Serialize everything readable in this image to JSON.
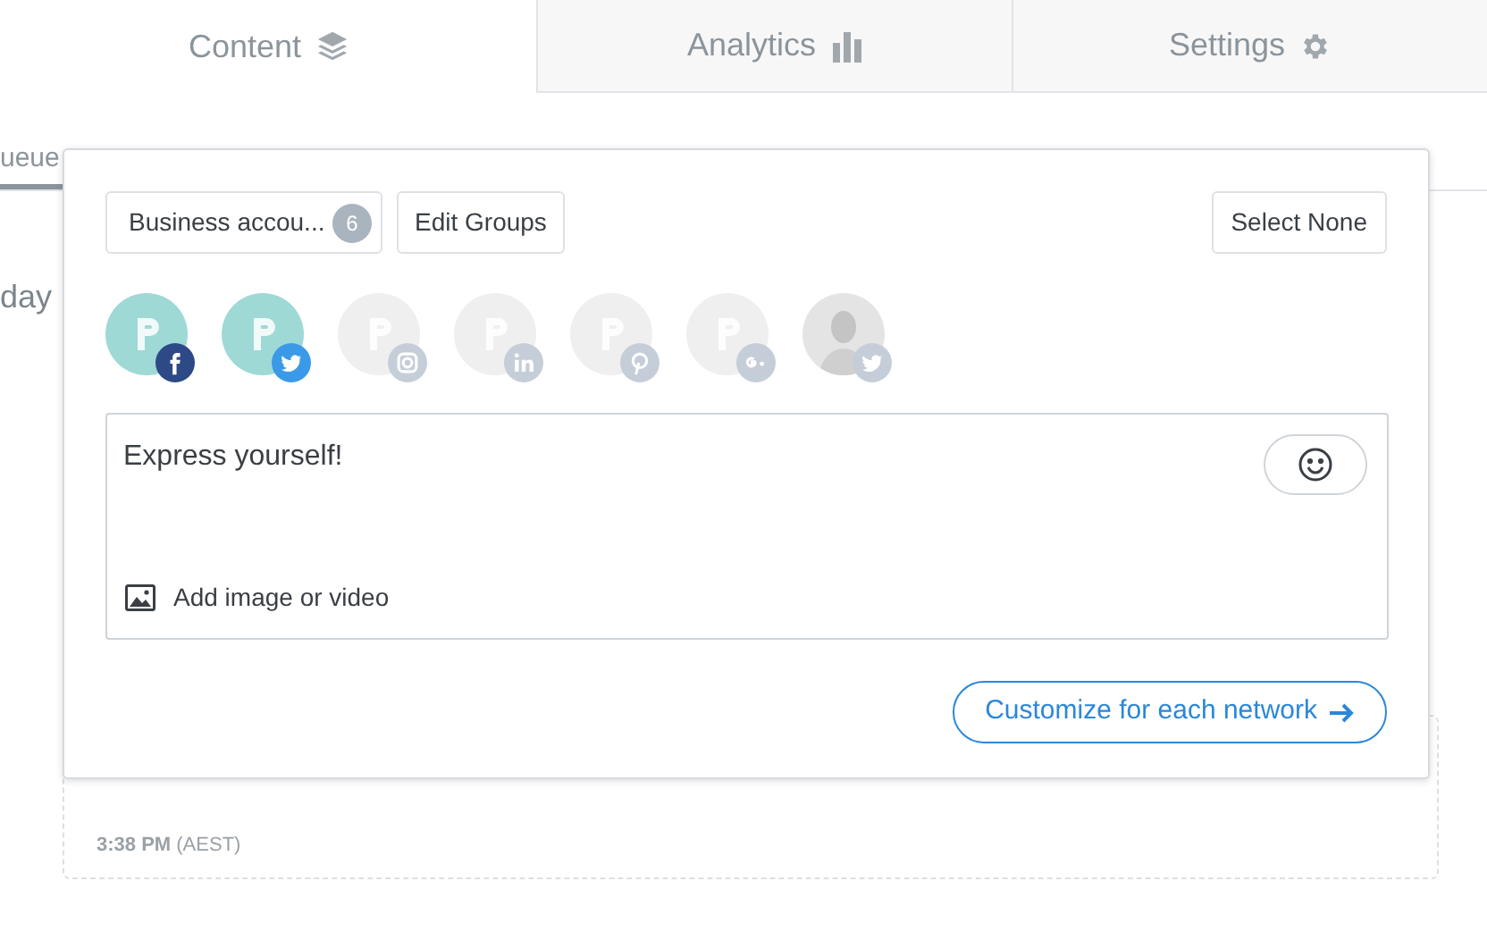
{
  "tabs": [
    {
      "label": "Content",
      "selected": true
    },
    {
      "label": "Analytics",
      "selected": false
    },
    {
      "label": "Settings",
      "selected": false
    }
  ],
  "subnav": {
    "label": "ueue",
    "selected": true
  },
  "day_heading": "day",
  "composer": {
    "group_button": {
      "label": "Business accou...",
      "count": "6"
    },
    "edit_groups": "Edit Groups",
    "select_none": "Select None",
    "accounts": [
      {
        "kind": "brand",
        "selected": true
      },
      {
        "kind": "brand",
        "selected": true
      },
      {
        "kind": "brand",
        "selected": false
      },
      {
        "kind": "brand",
        "selected": false
      },
      {
        "kind": "brand",
        "selected": false
      },
      {
        "kind": "brand",
        "selected": false
      },
      {
        "kind": "person",
        "selected": false
      }
    ],
    "message": {
      "placeholder": "Express yourself!"
    },
    "add_media": "Add image or video",
    "customize": "Customize for each network"
  },
  "slot": {
    "time": "3:38 PM",
    "zone": "(AEST)"
  }
}
